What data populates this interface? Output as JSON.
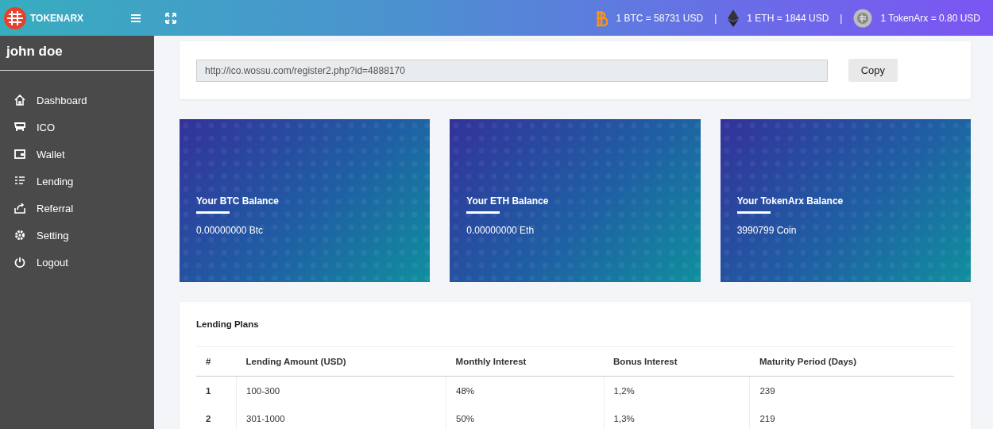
{
  "header": {
    "brand": "TOKENARX",
    "rates": [
      {
        "kind": "btc",
        "text": "1 BTC = 58731 USD"
      },
      {
        "kind": "sep",
        "text": "|"
      },
      {
        "kind": "eth",
        "text": "1 ETH = 1844 USD"
      },
      {
        "kind": "sep",
        "text": "|"
      },
      {
        "kind": "token",
        "text": "1 TokenArx = 0.80 USD"
      }
    ]
  },
  "sidebar": {
    "user": "john doe",
    "items": [
      {
        "label": "Dashboard",
        "selected": false
      },
      {
        "label": "ICO",
        "selected": false
      },
      {
        "label": "Wallet",
        "selected": false
      },
      {
        "label": "Lending",
        "selected": false
      },
      {
        "label": "Referral",
        "selected": false
      },
      {
        "label": "Setting",
        "selected": false
      },
      {
        "label": "Logout",
        "selected": false
      }
    ]
  },
  "referral": {
    "link": "http://ico.wossu.com/register2.php?id=4888170",
    "button": "Copy"
  },
  "balances": [
    {
      "title": "Your BTC Balance",
      "value": "0.00000000 Btc"
    },
    {
      "title": "Your ETH Balance",
      "value": "0.00000000 Eth"
    },
    {
      "title": "Your TokenArx Balance",
      "value": "3990799 Coin"
    }
  ],
  "lending_plans": {
    "title": "Lending Plans",
    "columns": [
      "#",
      "Lending Amount (USD)",
      "Monthly Interest",
      "Bonus Interest",
      "Maturity Period (Days)"
    ],
    "rows": [
      [
        "1",
        "100-300",
        "48%",
        "1,2%",
        "239"
      ],
      [
        "2",
        "301-1000",
        "50%",
        "1,3%",
        "219"
      ]
    ]
  }
}
